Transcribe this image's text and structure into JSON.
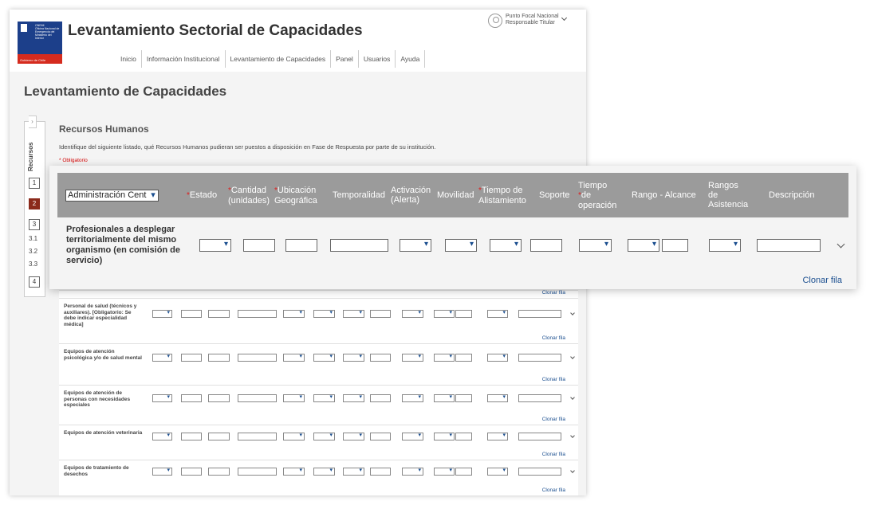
{
  "app": {
    "title": "Levantamiento Sectorial de Capacidades",
    "logo_text": "Gobierno de Chile",
    "logo_brand": "ONEMI",
    "logo_sub": "Oficina Nacional de Emergencia del Ministerio del Interior"
  },
  "user": {
    "name": "Punto Focal Nacional",
    "role": "Responsable Titular"
  },
  "nav": {
    "items": [
      "Inicio",
      "Información Institucional",
      "Levantamiento de Capacidades",
      "Panel",
      "Usuarios",
      "Ayuda"
    ]
  },
  "page": {
    "title": "Levantamiento de Capacidades"
  },
  "steps": {
    "vertical_label": "Recursos",
    "items": [
      "1",
      "2",
      "3"
    ],
    "subs": [
      "3.1",
      "3.2",
      "3.3"
    ],
    "last": "4",
    "active": "2",
    "arrow": "›"
  },
  "section": {
    "title": "Recursos Humanos",
    "description": "Identifique del siguiente listado, qué Recursos Humanos pudieran ser puestos a disposición en Fase de Respuesta por parte de su institución.",
    "required_note": "* Obligatorio"
  },
  "table": {
    "institution_select": "Administración Cent",
    "headers": {
      "estado": "Estado",
      "cantidad_1": "Cantidad",
      "cantidad_2": "(unidades)",
      "ubicacion_1": "Ubicación",
      "ubicacion_2": "Geográfica",
      "temporalidad": "Temporalidad",
      "activacion_1": "Activación",
      "activacion_2": "(Alerta)",
      "movilidad": "Movilidad",
      "tiempo_alist_1": "Tiempo de",
      "tiempo_alist_2": "Alistamiento",
      "soporte": "Soporte",
      "tiempo_op_1": "Tiempo",
      "tiempo_op_2": "de",
      "tiempo_op_3": "operación",
      "rango": "Rango - Alcance",
      "rangos_asist_1": "Rangos",
      "rangos_asist_2": "de",
      "rangos_asist_3": "Asistencia",
      "descripcion": "Descripción",
      "required_mark": "*"
    },
    "clone_label": "Clonar fila",
    "zoom_row_label": "Profesionales a desplegar territorialmente del mismo organismo (en comisión de servicio)",
    "rows": [
      "Personal de salud (técnicos y auxiliares). [Obligatorio: Se debe indicar especialidad médica]",
      "Equipos de atención psicológica y/o de salud mental",
      "Equipos de atención de personas con necesidades especiales",
      "Equipos de atención veterinaria",
      "Equipos de tratamiento de desechos"
    ]
  }
}
